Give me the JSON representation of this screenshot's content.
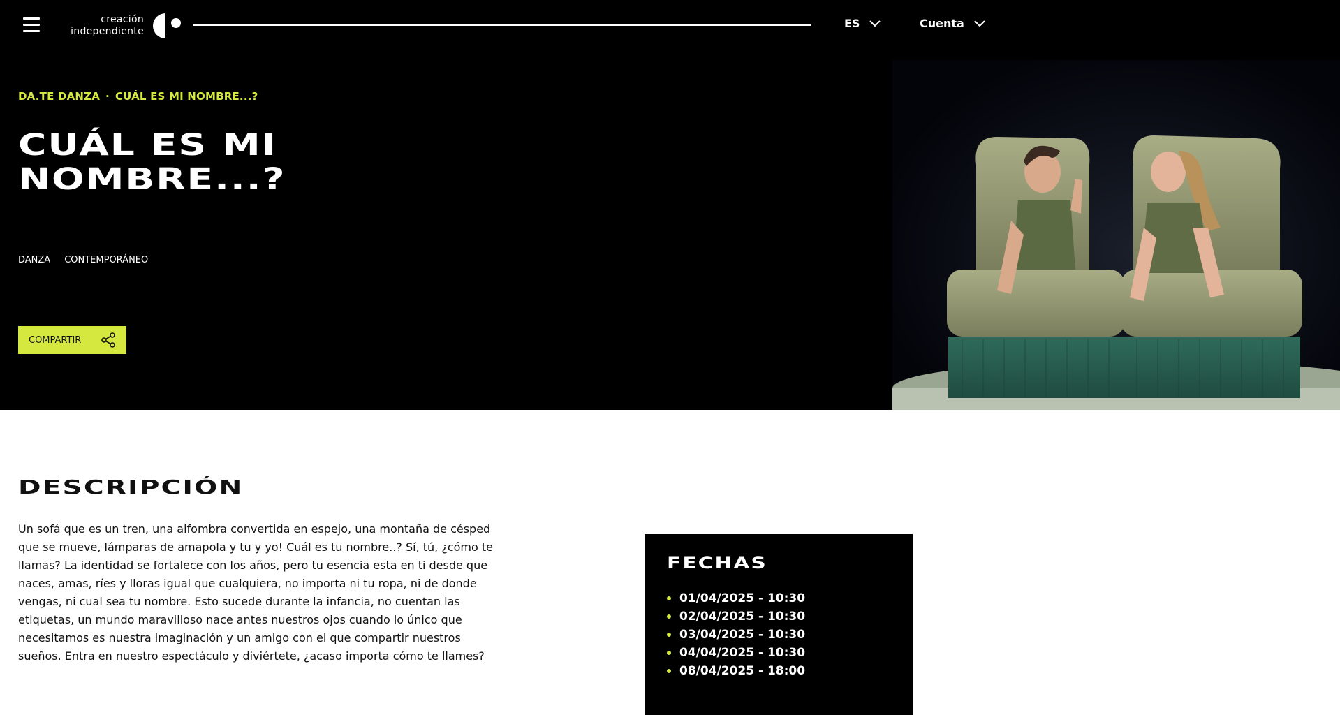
{
  "header": {
    "logo_line1": "creación",
    "logo_line2": "independiente",
    "language": "ES",
    "account": "Cuenta"
  },
  "hero": {
    "breadcrumb": [
      "DA.TE DANZA",
      "CUÁL ES MI NOMBRE...?"
    ],
    "breadcrumb_separator": "·",
    "title_line1": "CUÁL ES MI",
    "title_line2": "NOMBRE...?",
    "tags": [
      "DANZA",
      "CONTEMPORÁNEO"
    ],
    "share_label": "COMPARTIR"
  },
  "description": {
    "title": "DESCRIPCIÓN",
    "text": "Un sofá que es un tren, una alfombra convertida en espejo, una montaña de césped que se mueve, lámparas de amapola y tu y yo! Cuál es tu nombre..? Sí, tú, ¿cómo te llamas?  La identidad se fortalece con los años, pero tu esencia esta en ti desde que naces, amas, ríes y lloras igual que cualquiera, no importa ni tu ropa, ni de donde vengas, ni cual sea tu nombre.  Esto sucede durante la infancia, no cuentan las etiquetas, un mundo maravilloso nace antes nuestros ojos cuando lo único que necesitamos es nuestra imaginación y un amigo con el que compartir nuestros sueños.  Entra en nuestro espectáculo y diviértete, ¿acaso importa cómo te llames?"
  },
  "dates": {
    "title": "FECHAS",
    "items": [
      "01/04/2025 - 10:30",
      "02/04/2025 - 10:30",
      "03/04/2025 - 10:30",
      "04/04/2025 - 10:30",
      "08/04/2025 - 18:00"
    ]
  },
  "icons": [
    "menu-icon",
    "logo-mark-icon",
    "chevron-down-icon",
    "share-icon"
  ],
  "colors": {
    "accent": "#d4e83f",
    "background_dark": "#000000",
    "text_light": "#ffffff"
  }
}
